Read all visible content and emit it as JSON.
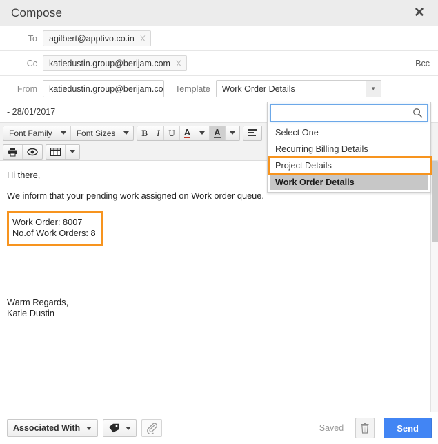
{
  "window": {
    "title": "Compose",
    "close_icon": "close-icon"
  },
  "recipients": {
    "to": {
      "label": "To",
      "chip": "agilbert@apptivo.co.in",
      "remove": "X"
    },
    "cc": {
      "label": "Cc",
      "chip": "katiedustin.group@berijam.com",
      "remove": "X"
    },
    "bcc_label": "Bcc"
  },
  "from": {
    "label": "From",
    "value": "katiedustin.group@berijam.com"
  },
  "template": {
    "label": "Template",
    "value": "Work Order Details",
    "search_value": "",
    "search_placeholder": "",
    "options": [
      "Select One",
      "Recurring Billing Details",
      "Project Details",
      "Work Order Details"
    ],
    "selected_index": 3,
    "highlight_color": "#f7941e"
  },
  "date_line": "- 28/01/2017",
  "toolbar": {
    "row1": [
      {
        "label": "Font Family",
        "name": "font-family-select",
        "caret": true
      },
      {
        "label": "Font Sizes",
        "name": "font-size-select",
        "caret": true
      },
      {
        "label": "B",
        "name": "bold-button",
        "caret": false
      },
      {
        "label": "I",
        "name": "italic-button",
        "caret": false
      },
      {
        "label": "U",
        "name": "underline-button",
        "caret": false
      },
      {
        "label": "A",
        "name": "font-color-button",
        "caret": true
      },
      {
        "label": "A",
        "name": "highlight-color-button",
        "caret": true
      },
      {
        "label": "align",
        "name": "align-left-button",
        "caret": false
      }
    ],
    "row2": [
      {
        "label": "print",
        "name": "print-button"
      },
      {
        "label": "preview",
        "name": "preview-eye-button"
      },
      {
        "label": "table",
        "name": "table-button"
      }
    ]
  },
  "body": {
    "greeting": "Hi there,",
    "paragraph": "We inform that your pending work assigned on Work order queue.",
    "boxed_lines": [
      "Work Order: 8007",
      "No.of Work Orders: 8"
    ],
    "signature_lines": [
      "Warm Regards,",
      "Katie  Dustin"
    ]
  },
  "footer": {
    "associated_with": "Associated With",
    "tag_icon": "tag-icon",
    "attach_icon": "paperclip-icon",
    "status": "Saved",
    "trash_icon": "trash-icon",
    "send_label": "Send",
    "send_color": "#4285f4"
  }
}
